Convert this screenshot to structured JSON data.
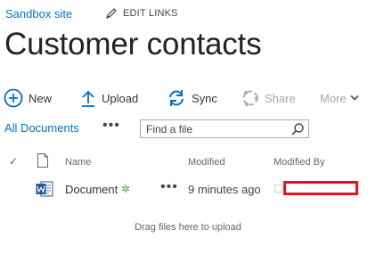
{
  "site": {
    "name": "Sandbox site",
    "edit_links_label": "EDIT LINKS"
  },
  "page": {
    "title": "Customer contacts"
  },
  "toolbar": {
    "new_label": "New",
    "upload_label": "Upload",
    "sync_label": "Sync",
    "share_label": "Share",
    "more_label": "More"
  },
  "view": {
    "current_view": "All Documents",
    "ellipsis": "•••",
    "search_placeholder": "Find a file"
  },
  "columns": {
    "check": "✓",
    "name": "Name",
    "modified": "Modified",
    "modified_by": "Modified By"
  },
  "documents": [
    {
      "name": "Document",
      "new_badge": "✲",
      "ellipsis": "•••",
      "modified": "9 minutes ago",
      "modified_by": ""
    }
  ],
  "drag_hint": "Drag files here to upload",
  "colors": {
    "accent": "#0072c6",
    "redaction": "#e0141e",
    "new_badge": "#4aa63a",
    "disabled": "#a6a6a6"
  }
}
